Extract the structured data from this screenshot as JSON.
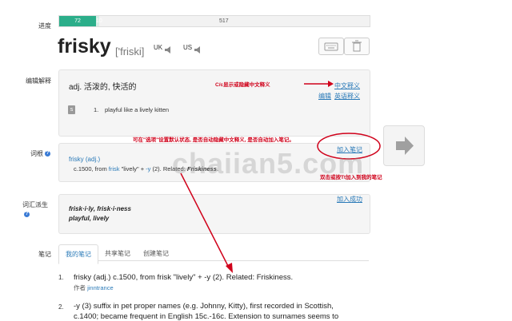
{
  "progress": {
    "label": "进度",
    "done": "72",
    "learning": "10",
    "remaining": "517",
    "done_fraction": 0.1193,
    "learning_fraction": 0.0083
  },
  "word": {
    "text": "frisky",
    "phonetic": "['friski]",
    "uk_label": "UK",
    "us_label": "US"
  },
  "definition": {
    "section_label": "编辑解释",
    "text": "adj. 活泼的, 快活的",
    "cn_link": "中文释义",
    "edit_link": "编辑",
    "en_link": "英语释义",
    "en_tag": "s",
    "en_item_num": "1.",
    "en_item_text": "playful like a lively kitten"
  },
  "etymology": {
    "section_label": "词根",
    "add_note": "加入笔记",
    "title": "frisky (adj.)",
    "body_prefix": "c.1500, from ",
    "link_frisk": "frisk",
    "body_mid": " \"lively\" + ",
    "link_y": "-y",
    "body_suffix": " (2). Related: ",
    "related": "Friskiness",
    "end": "."
  },
  "derivatives": {
    "section_label": "词汇派生",
    "added": "加入成功",
    "line1": "frisk·i·ly, frisk·i·ness",
    "line2": "playful, lively"
  },
  "notes": {
    "section_label": "笔记",
    "tabs": [
      "我的笔记",
      "共享笔记",
      "创建笔记"
    ],
    "items": [
      {
        "num": "1.",
        "text": "frisky (adj.) c.1500, from frisk \"lively\" + -y (2). Related: Friskiness.",
        "author_label": "作者",
        "author": "jinntrance"
      },
      {
        "num": "2.",
        "line1": "-y (3) suffix in pet proper names (e.g. Johnny, Kitty), first recorded in Scottish,",
        "line2": "c.1400; became frequent in English 15c.-16c. Extension to surnames seems to"
      }
    ]
  },
  "annotations": {
    "toggle_cn": "C/c显示或隐藏中文释义",
    "options_hint": "可在\"选项\"设置默认状态, 是否自动隐藏中文释义, 是否自动加入笔记。",
    "dblclick_hint": "双击或按Tt加入到我的笔记"
  },
  "watermark": "chaiian5.com",
  "colors": {
    "progress_done": "#2bae8a",
    "link": "#2a7ab8",
    "annotation": "#d0021b"
  }
}
